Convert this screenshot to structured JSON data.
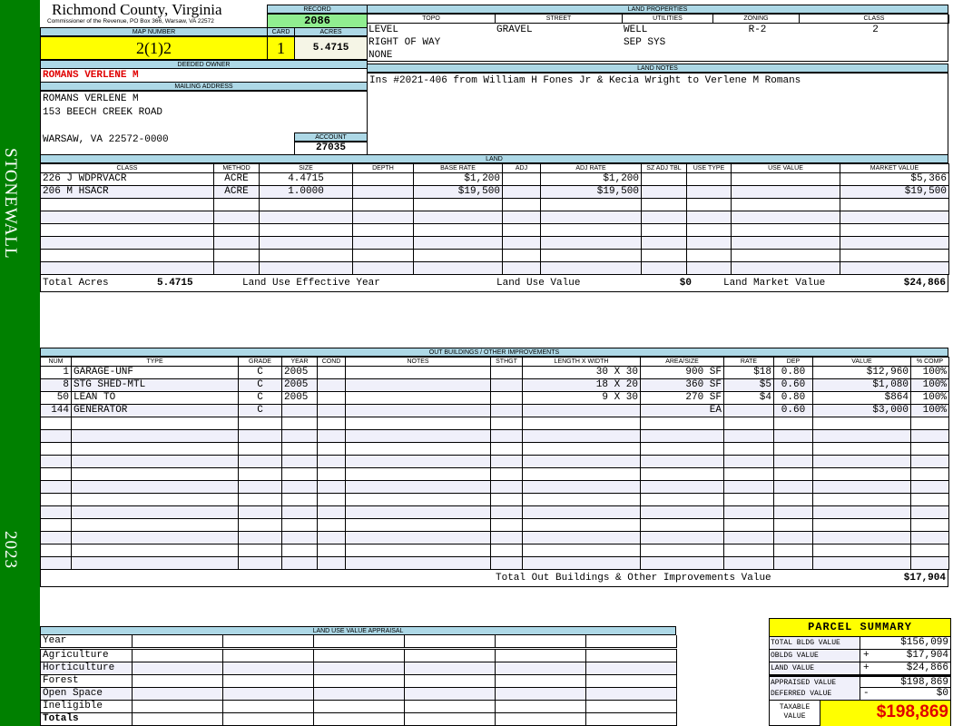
{
  "sidebar": {
    "district": "STONEWALL",
    "year": "2023",
    "color": "#008000"
  },
  "header": {
    "county": "Richmond County, Virginia",
    "office": "Commissioner of the Revenue, PO Box 366, Warsaw, VA 22572",
    "record_label": "RECORD",
    "record": "2086",
    "map_label": "MAP NUMBER",
    "map_number": "2(1)2",
    "card_label": "CARD",
    "card": "1",
    "acres_label": "ACRES",
    "acres": "5.4715"
  },
  "owner": {
    "deeded_label": "DEEDED OWNER",
    "deeded": "ROMANS VERLENE M",
    "mailing_label": "MAILING ADDRESS",
    "lines": [
      "ROMANS VERLENE M",
      "153 BEECH CREEK ROAD",
      "",
      "WARSAW, VA 22572-0000"
    ],
    "account_label": "ACCOUNT",
    "account": "27035"
  },
  "land_properties": {
    "title": "LAND PROPERTIES",
    "columns": [
      "TOPO",
      "STREET",
      "UTILITIES",
      "ZONING",
      "CLASS"
    ],
    "rows": [
      [
        "LEVEL",
        "GRAVEL",
        "WELL",
        "R-2",
        "2"
      ],
      [
        "RIGHT OF WAY",
        "",
        "SEP SYS",
        "",
        ""
      ],
      [
        "NONE",
        "",
        "",
        "",
        ""
      ]
    ]
  },
  "land_notes": {
    "title": "LAND NOTES",
    "text": "Ins #2021-406 from William H Fones Jr & Kecia Wright to Verlene M Romans"
  },
  "land": {
    "title": "LAND",
    "columns": [
      "CLASS",
      "METHOD",
      "SIZE",
      "DEPTH",
      "BASE RATE",
      "ADJ",
      "ADJ RATE",
      "SZ ADJ TBL",
      "USE TYPE",
      "USE VALUE",
      "MARKET VALUE"
    ],
    "rows": [
      [
        "226 J WDPRVACR",
        "ACRE",
        "4.4715",
        "",
        "$1,200",
        "",
        "$1,200",
        "",
        "",
        "",
        "$5,366"
      ],
      [
        "206 M HSACR",
        "ACRE",
        "1.0000",
        "",
        "$19,500",
        "",
        "$19,500",
        "",
        "",
        "",
        "$19,500"
      ]
    ],
    "totals": {
      "acres_label": "Total Acres",
      "acres": "5.4715",
      "effective_year_label": "Land Use Effective Year",
      "effective_year": "",
      "use_value_label": "Land Use Value",
      "use_value": "$0",
      "market_label": "Land Market Value",
      "market": "$24,866"
    }
  },
  "outbuildings": {
    "title": "OUT BUILDINGS / OTHER IMPROVEMENTS",
    "columns": [
      "NUM",
      "TYPE",
      "GRADE",
      "YEAR",
      "COND",
      "NOTES",
      "STHGT",
      "LENGTH X WIDTH",
      "AREA/SIZE",
      "RATE",
      "DEP",
      "VALUE",
      "% COMP"
    ],
    "rows": [
      [
        "1",
        "GARAGE-UNF",
        "C",
        "2005",
        "",
        "",
        "",
        "30 X 30",
        "900 SF",
        "$18",
        "0.80",
        "$12,960",
        "100%"
      ],
      [
        "8",
        "STG SHED-MTL",
        "C",
        "2005",
        "",
        "",
        "",
        "18 X 20",
        "360 SF",
        "$5",
        "0.60",
        "$1,080",
        "100%"
      ],
      [
        "50",
        "LEAN TO",
        "C",
        "2005",
        "",
        "",
        "",
        "9 X 30",
        "270 SF",
        "$4",
        "0.80",
        "$864",
        "100%"
      ],
      [
        "144",
        "GENERATOR",
        "C",
        "",
        "",
        "",
        "",
        "",
        "EA",
        "",
        "0.60",
        "$3,000",
        "100%"
      ]
    ],
    "total_label": "Total Out Buildings & Other Improvements Value",
    "total": "$17,904"
  },
  "land_use_appraisal": {
    "title": "LAND USE VALUE APPRAISAL",
    "year_label": "Year",
    "rows": [
      "Agriculture",
      "Horticulture",
      "Forest",
      "Open Space",
      "Ineligible"
    ],
    "totals_label": "Totals"
  },
  "parcel_summary": {
    "title": "PARCEL SUMMARY",
    "rows": [
      {
        "label": "TOTAL BLDG VALUE",
        "op": "",
        "value": "$156,099"
      },
      {
        "label": "OBLDG VALUE",
        "op": "+",
        "value": "$17,904"
      },
      {
        "label": "LAND VALUE",
        "op": "+",
        "value": "$24,866"
      },
      {
        "label": "APPRAISED VALUE",
        "op": "",
        "value": "$198,869"
      },
      {
        "label": "DEFERRED VALUE",
        "op": "-",
        "value": "$0"
      }
    ],
    "taxable_label": "TAXABLE VALUE",
    "taxable": "$198,869"
  }
}
